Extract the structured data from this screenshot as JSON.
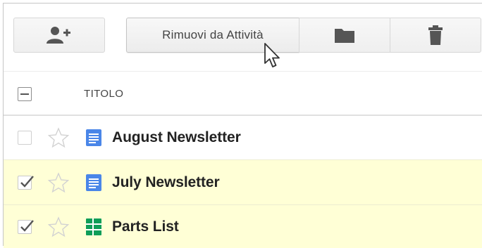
{
  "toolbar": {
    "add_user_icon": "add-person-icon",
    "remove_label": "Rimuovi da Attività",
    "folder_icon": "folder-icon",
    "trash_icon": "trash-icon"
  },
  "list": {
    "header": {
      "title": "TITOLO",
      "select_state": "partial"
    },
    "items": [
      {
        "name": "August Newsletter",
        "checked": false,
        "starred": false,
        "type": "document",
        "icon": "doc-icon",
        "icon_color": "#4a86e8"
      },
      {
        "name": "July Newsletter",
        "checked": true,
        "starred": false,
        "type": "document",
        "icon": "doc-icon",
        "icon_color": "#4a86e8"
      },
      {
        "name": "Parts List",
        "checked": true,
        "starred": false,
        "type": "spreadsheet",
        "icon": "sheet-icon",
        "icon_color": "#0f9d58"
      }
    ]
  },
  "colors": {
    "selected_row": "#ffffd6",
    "doc_blue": "#4a86e8",
    "sheet_green": "#0f9d58"
  }
}
